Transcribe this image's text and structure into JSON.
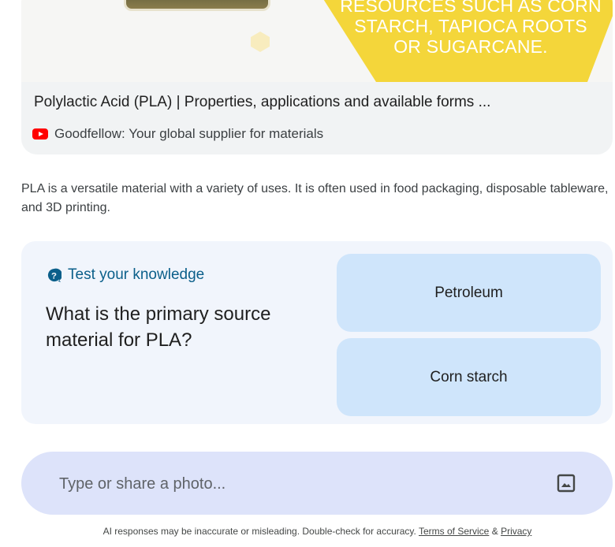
{
  "video": {
    "thumbnail_text": "RESOURCES SUCH AS CORN\nSTARCH, TAPIOCA ROOTS\nOR SUGARCANE.",
    "title": "Polylactic Acid (PLA) | Properties, applications and available forms ...",
    "source": "Goodfellow: Your global supplier for materials",
    "source_icon": "youtube-icon",
    "colors": {
      "banner_yellow": "#f4d63a",
      "youtube_red": "#ff0000"
    }
  },
  "description": "PLA is a versatile material with a variety of uses. It is often used in food packaging, disposable tableware, and 3D printing.",
  "quiz": {
    "header_icon": "question-bubble-icon",
    "header": "Test your knowledge",
    "question": "What is the primary source material for PLA?",
    "answers": [
      "Petroleum",
      "Corn starch"
    ],
    "colors": {
      "card_bg": "#f1f5fc",
      "answer_bg": "#cfe5fb",
      "header_color": "#0b5f8a"
    }
  },
  "input": {
    "placeholder": "Type or share a photo...",
    "value": "",
    "image_icon": "image-upload-icon",
    "bg_color": "#dde3fa"
  },
  "footer": {
    "disclaimer": "AI responses may be inaccurate or misleading. Double-check for accuracy.",
    "terms_label": "Terms of Service",
    "separator": "&",
    "privacy_label": "Privacy"
  }
}
